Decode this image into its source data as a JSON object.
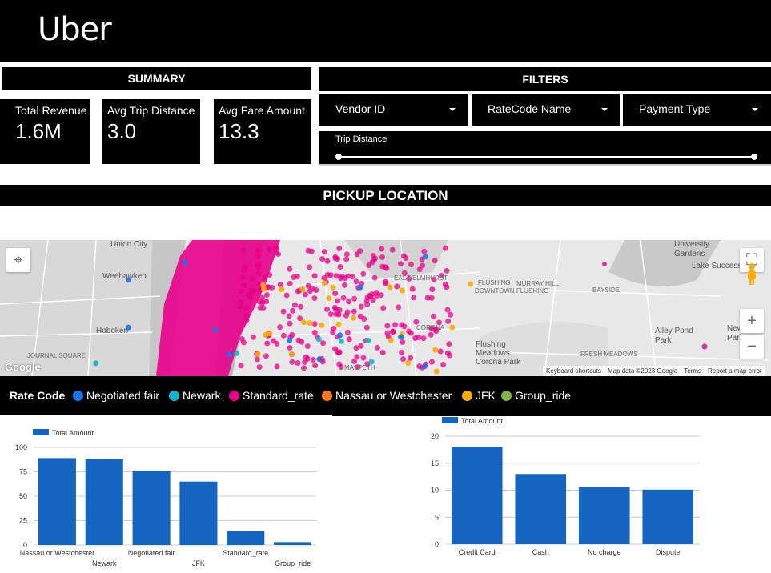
{
  "header": {
    "logo": "Uber"
  },
  "summary": {
    "title": "SUMMARY",
    "kpis": [
      {
        "label": "Total Revenue",
        "value": "1.6M"
      },
      {
        "label": "Avg Trip Distance",
        "value": "3.0"
      },
      {
        "label": "Avg Fare Amount",
        "value": "13.3"
      }
    ]
  },
  "filters": {
    "title": "FILTERS",
    "dropdowns": [
      {
        "label": "Vendor ID"
      },
      {
        "label": "RateCode Name"
      },
      {
        "label": "Payment Type"
      }
    ],
    "slider": {
      "label": "Trip Distance"
    }
  },
  "pickup": {
    "title": "PICKUP LOCATION"
  },
  "map": {
    "labels": [
      "Union City",
      "Weehawken",
      "Hoboken",
      "JOURNAL SQUARE",
      "EAST ELMHURST",
      "FLUSHING",
      "DOWNTOWN FLUSHING",
      "MURRAY HILL",
      "BAYSIDE",
      "CORONA",
      "Flushing Meadows Corona Park",
      "FRESH MEADOWS",
      "MASPETH",
      "University Gardens",
      "Lake Success",
      "Alley Pond Park",
      "New Hyde Park"
    ],
    "footer": [
      "Keyboard shortcuts",
      "Map data ©2023 Google",
      "Terms",
      "Report a map error"
    ],
    "google": "Google"
  },
  "legend": {
    "title": "Rate Code",
    "items": [
      {
        "label": "Negotiated fair",
        "color": "#1a73e8"
      },
      {
        "label": "Newark",
        "color": "#12b5cb"
      },
      {
        "label": "Standard_rate",
        "color": "#e8008a"
      },
      {
        "label": "Nassau or Westchester",
        "color": "#fa7b17"
      },
      {
        "label": "JFK",
        "color": "#f9ab00"
      },
      {
        "label": "Group_ride",
        "color": "#7cb342"
      }
    ]
  },
  "chart_data": [
    {
      "type": "bar",
      "series": [
        {
          "name": "Total Amount",
          "color": "#1565c0",
          "values": [
            89,
            88,
            76,
            65,
            14,
            3
          ]
        }
      ],
      "categories": [
        "Nassau or Westchester",
        "Newark",
        "Negotiated fair",
        "JFK",
        "Standard_rate",
        "Group_ride"
      ],
      "yticks": [
        0,
        25,
        50,
        75,
        100
      ],
      "ylim": [
        0,
        100
      ]
    },
    {
      "type": "bar",
      "series": [
        {
          "name": "Total Amount",
          "color": "#1565c0",
          "values": [
            18,
            13,
            10.6,
            10.1
          ]
        }
      ],
      "categories": [
        "Credit Card",
        "Cash",
        "No charge",
        "Dispute"
      ],
      "yticks": [
        0,
        5,
        10,
        15,
        20
      ],
      "ylim": [
        0,
        20
      ]
    }
  ]
}
